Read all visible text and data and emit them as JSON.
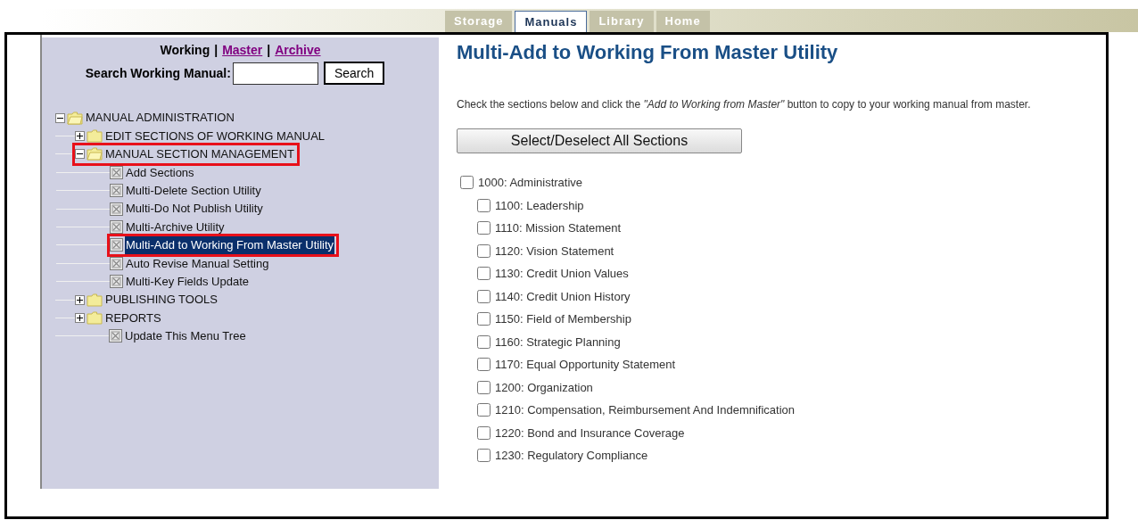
{
  "top_tabs": [
    {
      "label": "Storage",
      "selected": false
    },
    {
      "label": "Manuals",
      "selected": true
    },
    {
      "label": "Library",
      "selected": false
    },
    {
      "label": "Home",
      "selected": false
    }
  ],
  "sidebar": {
    "view_links": [
      {
        "label": "Working",
        "selected": true
      },
      {
        "label": "Master",
        "selected": false
      },
      {
        "label": "Archive",
        "selected": false
      }
    ],
    "separator": "|",
    "search_label": "Search Working Manual:",
    "search_button": "Search",
    "tree": [
      {
        "kind": "folder",
        "label": "MANUAL ADMINISTRATION",
        "expanded": true,
        "selected": false,
        "highlighted": false,
        "children": [
          {
            "kind": "folder",
            "label": "EDIT SECTIONS OF WORKING MANUAL",
            "expanded": false,
            "selected": false,
            "highlighted": false
          },
          {
            "kind": "folder",
            "label": "MANUAL SECTION MANAGEMENT",
            "expanded": true,
            "selected": false,
            "highlighted": true,
            "children": [
              {
                "kind": "page",
                "label": "Add Sections",
                "selected": false,
                "highlighted": false
              },
              {
                "kind": "page",
                "label": "Multi-Delete Section Utility",
                "selected": false,
                "highlighted": false
              },
              {
                "kind": "page",
                "label": "Multi-Do Not Publish Utility",
                "selected": false,
                "highlighted": false
              },
              {
                "kind": "page",
                "label": "Multi-Archive Utility",
                "selected": false,
                "highlighted": false
              },
              {
                "kind": "page",
                "label": "Multi-Add to Working From Master Utility",
                "selected": true,
                "highlighted": true
              },
              {
                "kind": "page",
                "label": "Auto Revise Manual Setting",
                "selected": false,
                "highlighted": false
              },
              {
                "kind": "page",
                "label": "Multi-Key Fields Update",
                "selected": false,
                "highlighted": false
              }
            ]
          },
          {
            "kind": "folder",
            "label": "PUBLISHING TOOLS",
            "expanded": false,
            "selected": false,
            "highlighted": false
          },
          {
            "kind": "folder",
            "label": "REPORTS",
            "expanded": false,
            "selected": false,
            "highlighted": false
          },
          {
            "kind": "page",
            "label": "Update This Menu Tree",
            "selected": false,
            "highlighted": false
          }
        ]
      }
    ]
  },
  "main": {
    "title": "Multi-Add to Working From Master Utility",
    "instructions": "Check the sections below and click the *\"Add to Working from Master\"* button to copy to your working manual from master.",
    "select_all_button": "Select/Deselect All Sections",
    "sections": [
      {
        "label": "1000: Administrative",
        "checked": false,
        "children": [
          {
            "label": "1100: Leadership",
            "checked": false
          },
          {
            "label": "1110: Mission Statement",
            "checked": false
          },
          {
            "label": "1120: Vision Statement",
            "checked": false
          },
          {
            "label": "1130: Credit Union Values",
            "checked": false
          },
          {
            "label": "1140: Credit Union History",
            "checked": false
          },
          {
            "label": "1150: Field of Membership",
            "checked": false
          },
          {
            "label": "1160: Strategic Planning",
            "checked": false
          },
          {
            "label": "1170: Equal Opportunity Statement",
            "checked": false
          },
          {
            "label": "1200: Organization",
            "checked": false
          },
          {
            "label": "1210: Compensation, Reimbursement And Indemnification",
            "checked": false
          },
          {
            "label": "1220: Bond and Insurance Coverage",
            "checked": false
          },
          {
            "label": "1230: Regulatory Compliance",
            "checked": false
          }
        ]
      }
    ]
  }
}
